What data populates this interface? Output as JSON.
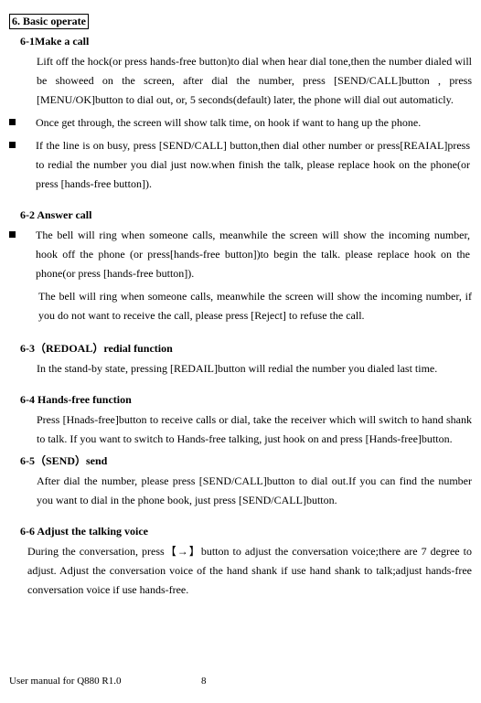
{
  "section_title": "6. Basic operate",
  "s61": {
    "title": "6-1Make a call",
    "p1": "Lift off the hock(or press hands-free button)to dial when hear dial tone,then the number dialed will be showeed on the screen, after dial the number, press [SEND/CALL]button , press [MENU/OK]button to dial out, or, 5 seconds(default) later, the phone will dial out automaticly.",
    "b1": "Once get through, the screen will show talk time, on hook if want to hang up the phone.",
    "b2": "If the line is on busy, press [SEND/CALL] button,then dial other number or press[REAIAL]press to redial the number you dial just now.when finish the talk, please replace hook on the phone(or press [hands-free button])."
  },
  "s62": {
    "title": "6-2 Answer call",
    "b1": "The bell will ring when someone calls, meanwhile the screen will show the incoming number, hook off the phone (or press[hands-free button])to begin the talk. please replace hook on the phone(or press [hands-free button]).",
    "p1": "The bell will ring when someone calls, meanwhile the screen will show the incoming number, if you do not want to receive the call, please press [Reject] to refuse the call."
  },
  "s63": {
    "title": "6-3（REDOAL）redial function",
    "p1": "In the stand-by state, pressing [REDAIL]button will redial the number you dialed last time."
  },
  "s64": {
    "title": "6-4 Hands-free function",
    "p1": "Press [Hnads-free]button to receive calls or dial, take the receiver which will switch to hand shank to talk. If you want to switch to Hands-free talking, just hook on and press [Hands-free]button."
  },
  "s65": {
    "title": "6-5（SEND）send",
    "p1": "After dial the number, please press [SEND/CALL]button to dial out.If you can find the number you want to dial in the phone book, just press [SEND/CALL]button."
  },
  "s66": {
    "title": "6-6 Adjust the talking voice",
    "p1": "During the conversation, press【→】button to adjust the conversation voice;there are 7 degree to adjust. Adjust the conversation voice of the hand   shank if use hand shank to talk;adjust hands-free conversation voice if use hands-free."
  },
  "footer": {
    "left": "User manual for Q880 R1.0",
    "page": "8"
  }
}
